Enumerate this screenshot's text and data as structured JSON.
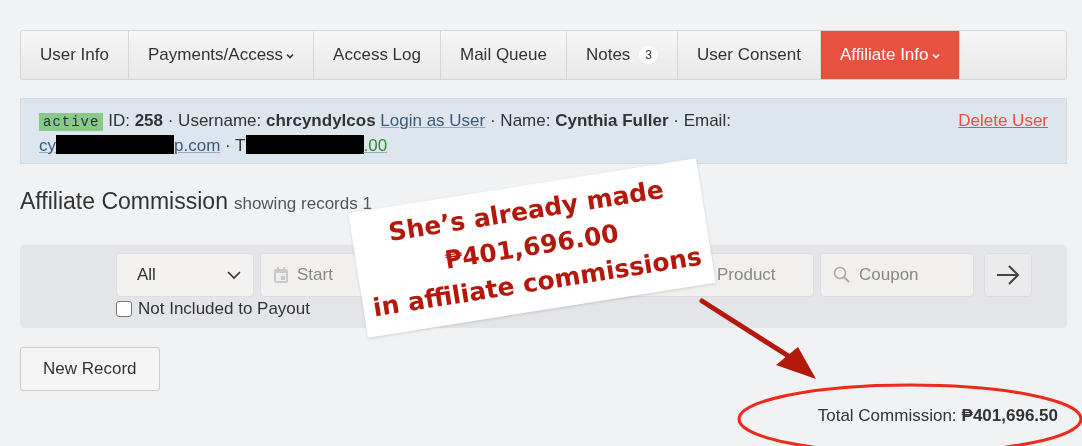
{
  "tabs": [
    {
      "label": "User Info",
      "selected": false,
      "dropdown": false
    },
    {
      "label": "Payments/Access",
      "selected": false,
      "dropdown": true
    },
    {
      "label": "Access Log",
      "selected": false,
      "dropdown": false
    },
    {
      "label": "Mail Queue",
      "selected": false,
      "dropdown": false
    },
    {
      "label": "Notes",
      "selected": false,
      "dropdown": false,
      "badge": "3"
    },
    {
      "label": "User Consent",
      "selected": false,
      "dropdown": false
    },
    {
      "label": "Affiliate Info",
      "selected": true,
      "dropdown": true
    }
  ],
  "user": {
    "status": "active",
    "id_label": "ID:",
    "id": "258",
    "username_label": "· Username:",
    "username": "chrcyndylcos",
    "login_link": "Login as User",
    "name_label": "· Name:",
    "name": "Cynthia Fuller",
    "email_label": "· Email:",
    "email_start": "cy",
    "email_end": "p.com",
    "phone_start": "· T",
    "amount_end": ".00",
    "delete_link": "Delete User"
  },
  "heading": {
    "title": "Affiliate Commission",
    "subtitle": "showing records 1"
  },
  "filters": {
    "select": "All",
    "date_placeholder": "Start",
    "product_placeholder": "Product",
    "coupon_placeholder": "Coupon",
    "checkbox": {
      "label": "Not Included to Payout",
      "checked": false
    }
  },
  "new_record": "New Record",
  "total": {
    "label": "Total Commission:",
    "value": "₱401,696.50"
  },
  "annotation": {
    "lines": [
      "She’s already made",
      "₱401,696.00",
      "in affiliate commissions"
    ]
  }
}
